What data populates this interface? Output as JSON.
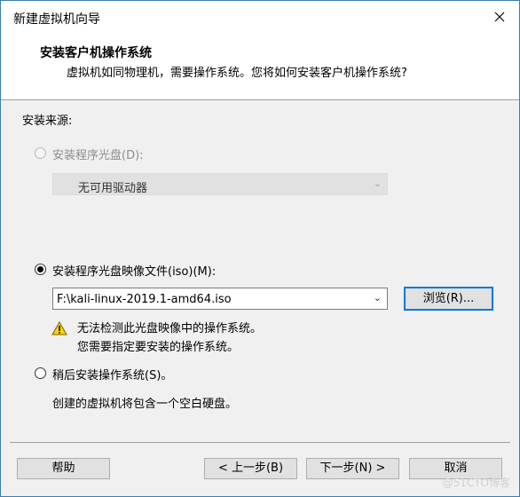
{
  "window": {
    "title": "新建虚拟机向导"
  },
  "header": {
    "title": "安装客户机操作系统",
    "subtitle": "虚拟机如同物理机，需要操作系统。您将如何安装客户机操作系统?"
  },
  "main": {
    "section_label": "安装来源:",
    "option_disc": {
      "label": "安装程序光盘(D):",
      "selected": false,
      "enabled": false
    },
    "disc_drive": {
      "value": "无可用驱动器",
      "enabled": false
    },
    "option_iso": {
      "label": "安装程序光盘映像文件(iso)(M):",
      "selected": true,
      "enabled": true
    },
    "iso_path": {
      "value": "F:\\kali-linux-2019.1-amd64.iso"
    },
    "browse_label": "浏览(R)...",
    "warning": {
      "line1": "无法检测此光盘映像中的操作系统。",
      "line2": "您需要指定要安装的操作系统。"
    },
    "option_later": {
      "label": "稍后安装操作系统(S)。",
      "selected": false,
      "enabled": true
    },
    "later_description": "创建的虚拟机将包含一个空白硬盘。"
  },
  "footer": {
    "help_label": "帮助",
    "back_label": "< 上一步(B)",
    "next_label": "下一步(N) >",
    "cancel_label": "取消"
  },
  "watermark": "@51CTO博客",
  "icons": {
    "close": "close-icon",
    "warning": "warning-icon",
    "dropdown": "chevron-down-icon"
  },
  "colors": {
    "accent": "#0078d7",
    "warning_fill": "#ffd400"
  }
}
